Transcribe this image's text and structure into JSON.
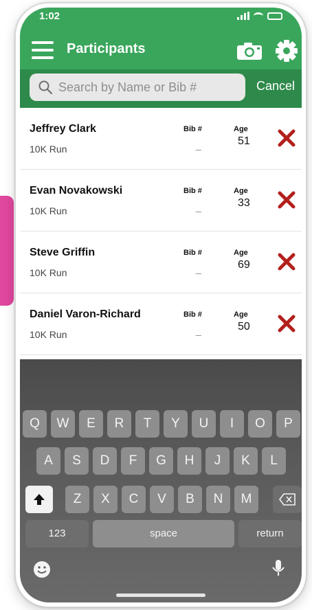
{
  "status_bar": {
    "time": "1:02"
  },
  "header": {
    "title": "Participants",
    "menu_icon": "hamburger-menu-icon",
    "camera_icon": "camera-icon",
    "settings_icon": "gear-icon"
  },
  "search": {
    "placeholder": "Search by Name or Bib #",
    "value": "",
    "cancel_label": "Cancel"
  },
  "list": {
    "bib_header": "Bib #",
    "age_header": "Age",
    "participants": [
      {
        "name": "Jeffrey Clark",
        "event": "10K Run",
        "bib": "_",
        "age": "51"
      },
      {
        "name": "Evan Novakowski",
        "event": "10K Run",
        "bib": "_",
        "age": "33"
      },
      {
        "name": "Steve Griffin",
        "event": "10K Run",
        "bib": "_",
        "age": "69"
      },
      {
        "name": "Daniel Varon-Richard",
        "event": "10K Run",
        "bib": "_",
        "age": "50"
      }
    ]
  },
  "keyboard": {
    "row1": [
      "Q",
      "W",
      "E",
      "R",
      "T",
      "Y",
      "U",
      "I",
      "O",
      "P"
    ],
    "row2": [
      "A",
      "S",
      "D",
      "F",
      "G",
      "H",
      "J",
      "K",
      "L"
    ],
    "row3": [
      "Z",
      "X",
      "C",
      "V",
      "B",
      "N",
      "M"
    ],
    "numbers_label": "123",
    "space_label": "space",
    "return_label": "return"
  },
  "colors": {
    "header_green": "#3aa65c",
    "search_bar_green": "#2e8a4a",
    "delete_red": "#b3201c",
    "accent_pink": "#e0479e"
  }
}
